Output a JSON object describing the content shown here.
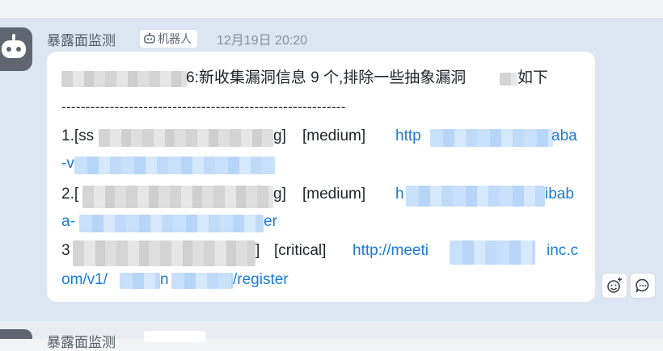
{
  "message": {
    "sender": "暴露面监测",
    "bot_badge": "机器人",
    "timestamp": "12月19日 20:20",
    "lines": {
      "intro": "6:新收集漏洞信息 9 个,排除一些抽象漏洞",
      "intro_tail": "如下",
      "separator": "-----------------------------------------------------------",
      "vuln1_prefix": "1.[ss",
      "vuln1_name_tail": "g]",
      "vuln1_severity": "[medium]",
      "vuln1_link": "http",
      "vuln1_link_tail": "aba",
      "vuln1_cont": "-v",
      "vuln2_prefix": "2.[",
      "vuln2_name_tail": "g]",
      "vuln2_severity": "[medium]",
      "vuln2_link": "h",
      "vuln2_link_tail": "ibab",
      "vuln2_cont": "a-",
      "vuln2_cont_tail": "er",
      "vuln3_prefix": "3",
      "vuln3_name_tail": "]",
      "vuln3_severity": "[critical]",
      "vuln3_link": "http://meeti",
      "vuln3_link_tail": "inc.c",
      "vuln3_cont": "om/v1/",
      "vuln3_cont_mid": "n",
      "vuln3_cont_tail": "/register"
    }
  },
  "next_message": {
    "sender": "暴露面监测"
  },
  "actions": [
    {
      "name": "add-reaction-button",
      "icon": "emoji-plus-icon"
    },
    {
      "name": "reply-button",
      "icon": "comment-icon"
    }
  ],
  "colors": {
    "chat_background": "#dbe6f2",
    "bubble": "#ffffff",
    "link": "#1a7ad9",
    "avatar": "#5f6670"
  }
}
